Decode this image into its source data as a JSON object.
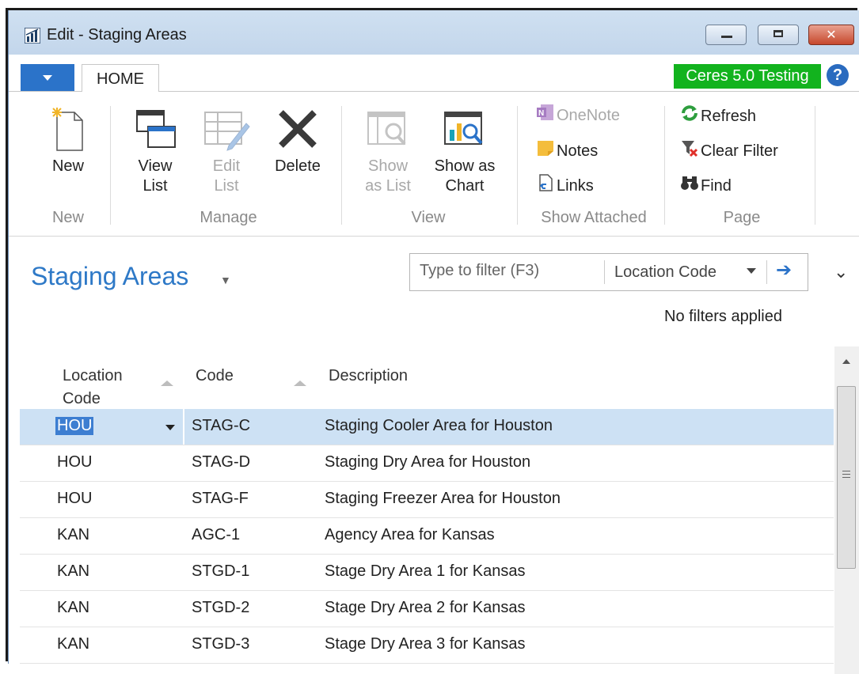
{
  "window": {
    "title": "Edit - Staging Areas",
    "minimize_glyph": "",
    "close_glyph": "✕"
  },
  "tabs": {
    "file_menu": "",
    "home": "HOME",
    "environment_badge": "Ceres 5.0 Testing",
    "help": "?"
  },
  "ribbon": {
    "groups": [
      {
        "label": "New"
      },
      {
        "label": "Manage"
      },
      {
        "label": "View"
      },
      {
        "label": "Show Attached"
      },
      {
        "label": "Page"
      }
    ],
    "new": {
      "label": "New"
    },
    "view_list": {
      "line1": "View",
      "line2": "List"
    },
    "edit_list": {
      "line1": "Edit",
      "line2": "List"
    },
    "delete": {
      "label": "Delete"
    },
    "show_as_list": {
      "line1": "Show",
      "line2": "as List"
    },
    "show_as_chart": {
      "line1": "Show as",
      "line2": "Chart"
    },
    "onenote": "OneNote",
    "notes": "Notes",
    "links": "Links",
    "refresh": "Refresh",
    "clear_filter": "Clear Filter",
    "find": "Find"
  },
  "page": {
    "title": "Staging Areas",
    "filter": {
      "placeholder": "Type to filter (F3)",
      "field": "Location Code"
    },
    "filter_status": "No filters applied"
  },
  "table": {
    "columns": [
      {
        "line1": "Location",
        "line2": "Code"
      },
      {
        "line1": "Code",
        "line2": ""
      },
      {
        "line1": "Description",
        "line2": ""
      }
    ],
    "rows": [
      {
        "location_code": "HOU",
        "code": "STAG-C",
        "description": "Staging Cooler Area for Houston",
        "selected": true
      },
      {
        "location_code": "HOU",
        "code": "STAG-D",
        "description": "Staging Dry Area for Houston"
      },
      {
        "location_code": "HOU",
        "code": "STAG-F",
        "description": "Staging Freezer Area for Houston"
      },
      {
        "location_code": "KAN",
        "code": "AGC-1",
        "description": "Agency Area for Kansas"
      },
      {
        "location_code": "KAN",
        "code": "STGD-1",
        "description": "Stage Dry Area 1 for Kansas"
      },
      {
        "location_code": "KAN",
        "code": "STGD-2",
        "description": "Stage Dry Area 2 for Kansas"
      },
      {
        "location_code": "KAN",
        "code": "STGD-3",
        "description": "Stage Dry Area 3 for Kansas"
      }
    ]
  },
  "colors": {
    "accent": "#2b73c9",
    "title": "#2e79c7",
    "badge": "#12b31e",
    "selected_row": "#cde1f4",
    "disabled_text": "#a8a8a8"
  }
}
